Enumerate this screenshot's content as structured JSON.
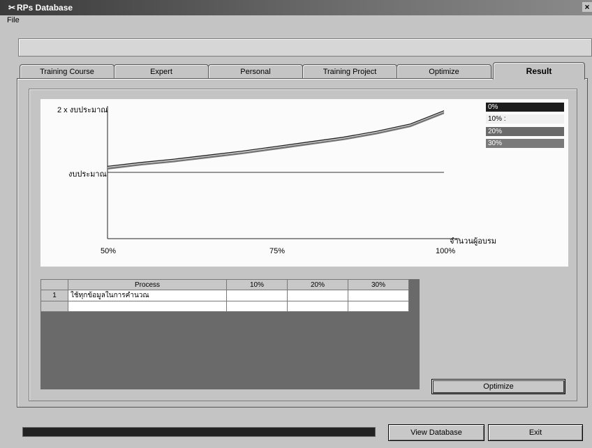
{
  "window": {
    "title": "RPs Database",
    "app_icon": "✂",
    "close_glyph": "×"
  },
  "menu": {
    "file": "File"
  },
  "top_field": {
    "value": ""
  },
  "tabs": [
    {
      "label": "Training Course",
      "active": false
    },
    {
      "label": "Expert",
      "active": false
    },
    {
      "label": "Personal",
      "active": false
    },
    {
      "label": "Training Project",
      "active": false
    },
    {
      "label": "Optimize",
      "active": false
    },
    {
      "label": "Result",
      "active": true
    }
  ],
  "chart": {
    "y_top_label": "2 x งบประมาณ",
    "y_mid_label": "งบประมาณ",
    "x_axis_label": "จำนวนผู้อบรม",
    "x_ticks": [
      "50%",
      "75%",
      "100%"
    ],
    "legend": [
      {
        "label": "0%",
        "color": "#1c1c1c"
      },
      {
        "label": "10% :",
        "color": "#f0f0f0"
      },
      {
        "label": "20%",
        "color": "#6a6a6a"
      },
      {
        "label": "30%",
        "color": "#7a7a7a"
      }
    ]
  },
  "chart_data": {
    "type": "line",
    "x_ticks": [
      "50%",
      "75%",
      "100%"
    ],
    "y_ticks": [
      "งบประมาณ",
      "2 x งบประมาณ"
    ],
    "xlabel": "จำนวนผู้อบรม",
    "ylabel": "",
    "x": [
      50,
      55,
      60,
      65,
      70,
      75,
      80,
      85,
      90,
      95,
      100
    ],
    "ylim": [
      0,
      2
    ],
    "reference_line": 1,
    "series": [
      {
        "name": "0%",
        "values": [
          1.09,
          1.15,
          1.2,
          1.26,
          1.32,
          1.39,
          1.46,
          1.53,
          1.62,
          1.73,
          1.93
        ]
      },
      {
        "name": "10%",
        "values": [
          1.07,
          1.13,
          1.18,
          1.24,
          1.3,
          1.37,
          1.44,
          1.51,
          1.6,
          1.71,
          1.91
        ]
      },
      {
        "name": "20%",
        "values": [
          1.06,
          1.12,
          1.17,
          1.23,
          1.29,
          1.36,
          1.43,
          1.5,
          1.59,
          1.7,
          1.9
        ]
      },
      {
        "name": "30%",
        "values": [
          1.05,
          1.11,
          1.16,
          1.22,
          1.28,
          1.35,
          1.42,
          1.49,
          1.58,
          1.69,
          1.89
        ]
      }
    ]
  },
  "grid": {
    "columns": [
      "",
      "Process",
      "10%",
      "20%",
      "30%"
    ],
    "rows": [
      [
        "1",
        "ใช้ทุกข้อมูลในการคำนวณ",
        "",
        "",
        ""
      ],
      [
        "",
        "",
        "",
        "",
        ""
      ]
    ]
  },
  "buttons": {
    "optimize": "Optimize",
    "view_database": "View Database",
    "exit": "Exit"
  },
  "progress": {
    "value": 1.0
  }
}
